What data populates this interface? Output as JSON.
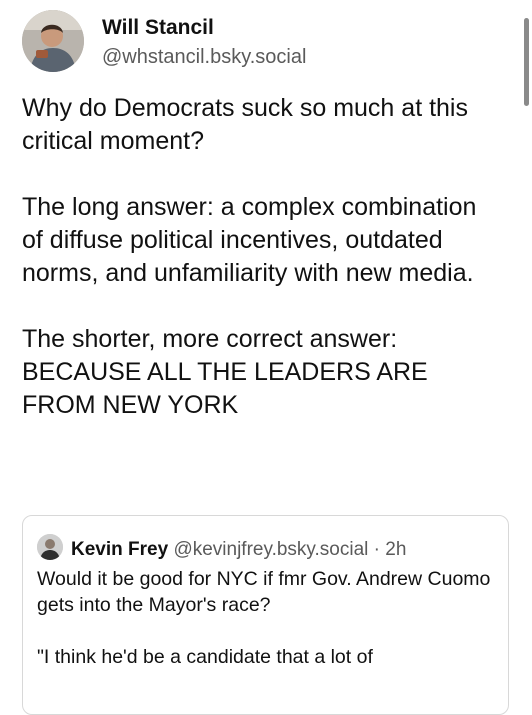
{
  "author": {
    "name": "Will Stancil",
    "handle": "@whstancil.bsky.social"
  },
  "post": {
    "paragraphs": [
      "Why do Democrats suck so much at this critical moment?",
      "The long answer: a complex combination of diffuse political incentives, outdated norms, and unfamiliarity with new media.",
      "The shorter, more correct answer: BECAUSE ALL THE LEADERS ARE FROM NEW YORK"
    ]
  },
  "quote": {
    "name": "Kevin Frey",
    "handle": "@kevinjfrey.bsky.social",
    "separator": "·",
    "time": "2h",
    "paragraphs": [
      "Would it be good for NYC if fmr Gov. Andrew Cuomo gets into the Mayor's race?",
      "\"I think he'd be a candidate that a lot of"
    ]
  }
}
